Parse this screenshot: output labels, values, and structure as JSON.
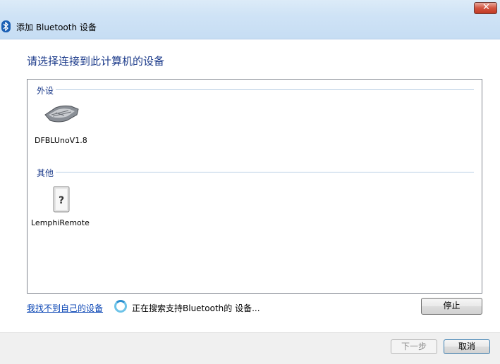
{
  "window": {
    "title": "添加 Bluetooth 设备",
    "icon": "bluetooth-icon",
    "close_icon": "close-icon"
  },
  "heading": "请选择连接到此计算机的设备",
  "groups": [
    {
      "name": "外设",
      "devices": [
        {
          "label": "DFBLUnoV1.8",
          "icon": "keyboard-icon"
        }
      ]
    },
    {
      "name": "其他",
      "devices": [
        {
          "label": "LemphiRemote",
          "icon": "unknown-device-icon"
        }
      ]
    }
  ],
  "link_text": "我找不到自己的设备",
  "status_text": "正在搜索支持Bluetooth的 设备...",
  "buttons": {
    "stop": "停止",
    "next": "下一步",
    "cancel": "取消"
  },
  "colors": {
    "heading": "#1b3a8a",
    "link": "#0b46b5",
    "close": "#c23a25"
  }
}
